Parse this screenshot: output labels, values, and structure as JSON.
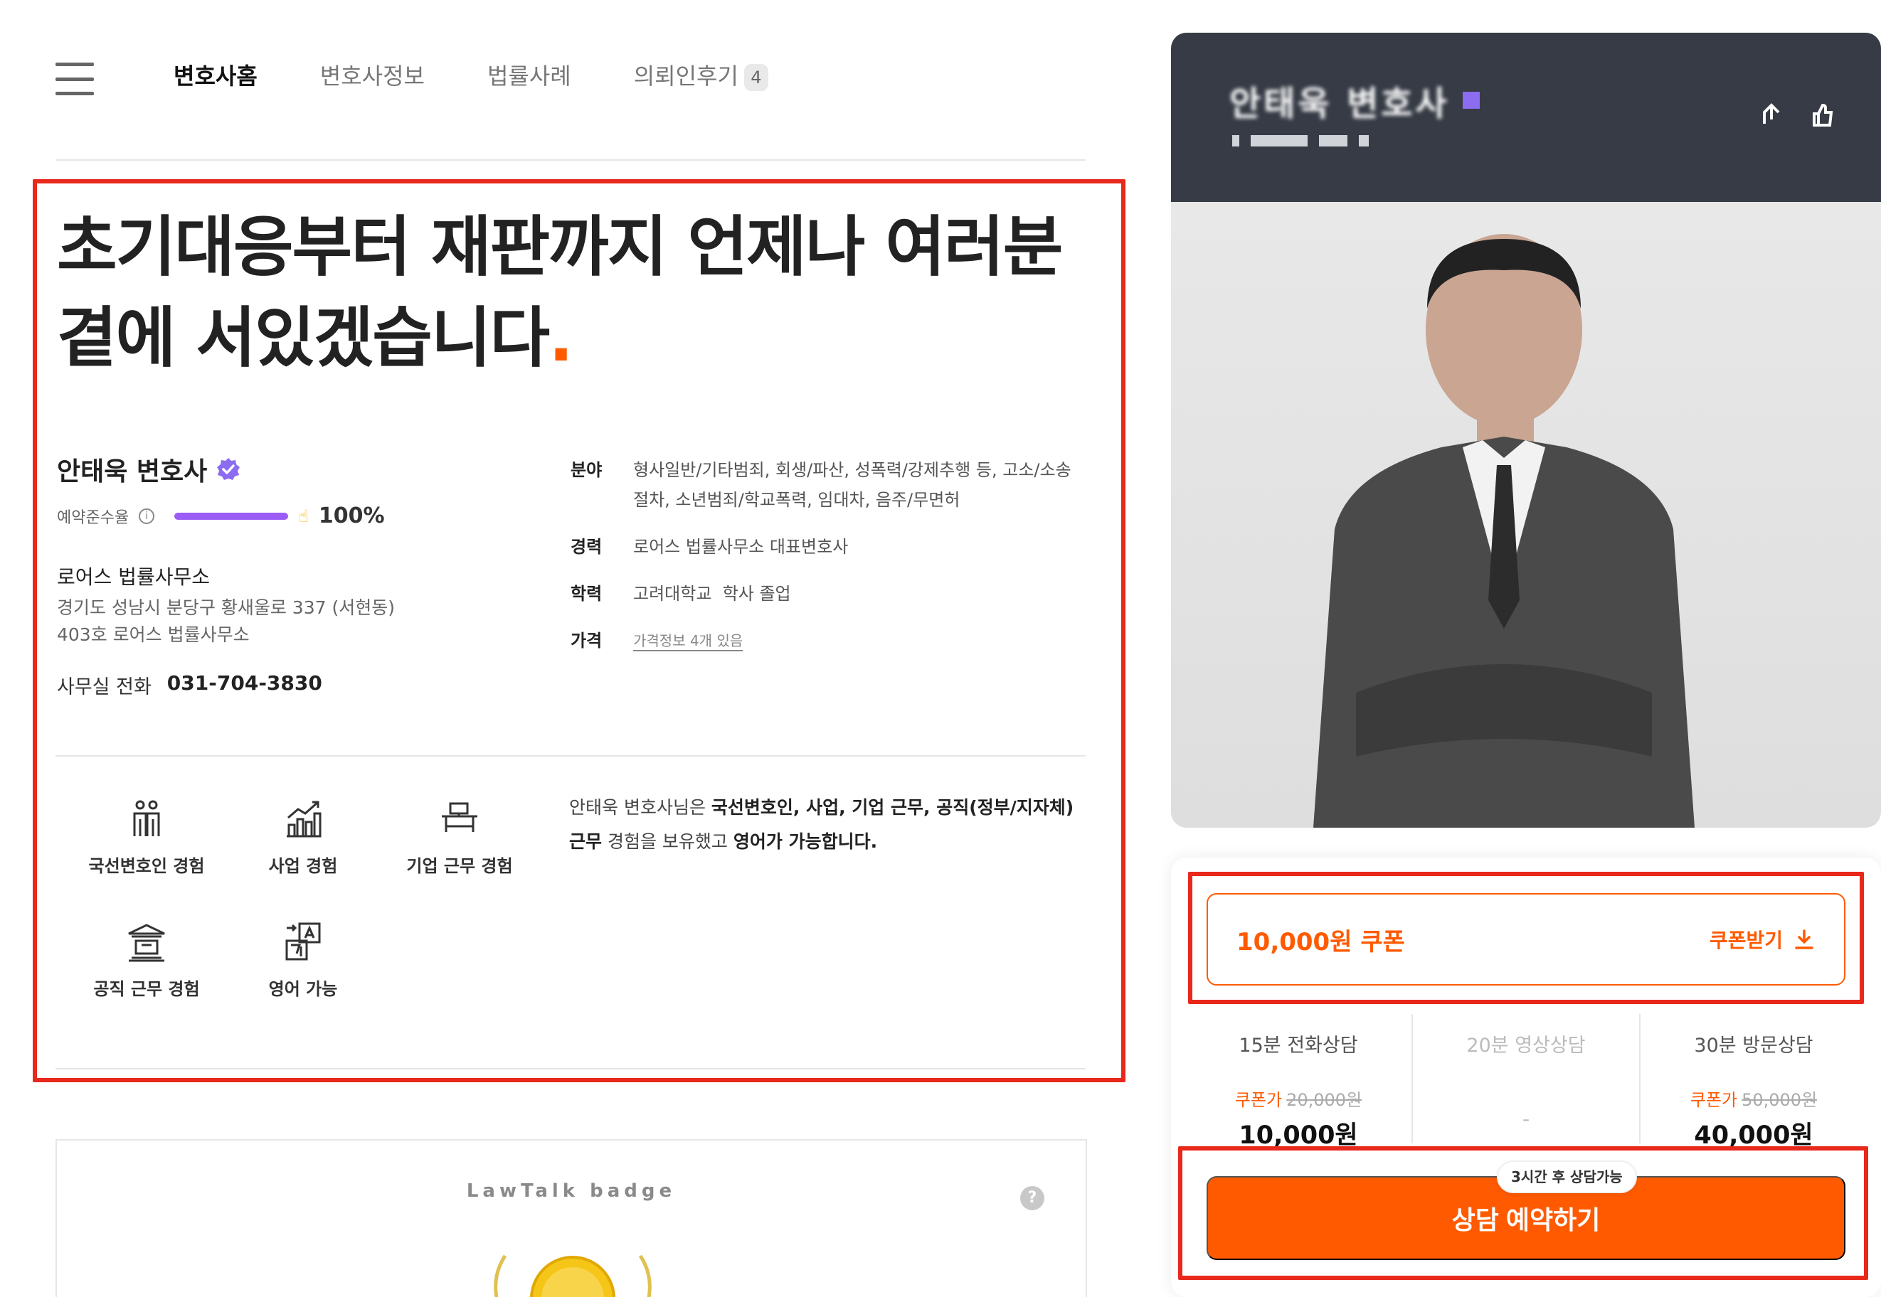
{
  "nav": {
    "tabs": [
      {
        "label": "변호사홈"
      },
      {
        "label": "변호사정보"
      },
      {
        "label": "법률사례"
      },
      {
        "label": "의뢰인후기",
        "count": "4"
      }
    ]
  },
  "headline": {
    "line1": "초기대응부터 재판까지 언제나 여러분",
    "line2": "곁에 서있겠습니다",
    "dot": "."
  },
  "lawyer": {
    "name": "안태욱 변호사",
    "rate_label": "예약준수율",
    "rate_value": "100%",
    "rate_fraction": 1.0,
    "office_name": "로어스 법률사무소",
    "address_line1": "경기도 성남시 분당구 황새울로 337 (서현동)",
    "address_line2": "403호 로어스 법률사무소",
    "phone_label": "사무실 전화",
    "phone": "031-704-3830"
  },
  "info": [
    {
      "key": "분야",
      "value": "형사일반/기타범죄, 회생/파산, 성폭력/강제추행 등, 고소/소송절차, 소년범죄/학교폭력, 임대차, 음주/무면허"
    },
    {
      "key": "경력",
      "value": "로어스 법률사무소 대표변호사"
    },
    {
      "key": "학력",
      "value": "고려대학교  학사 졸업"
    },
    {
      "key": "가격",
      "value": "가격정보 4개 있음"
    }
  ],
  "experiences": [
    {
      "label": "국선변호인 경험",
      "icon": "people-icon"
    },
    {
      "label": "사업 경험",
      "icon": "growth-chart-icon"
    },
    {
      "label": "기업 근무 경험",
      "icon": "desk-icon"
    },
    {
      "label": "공직 근무 경험",
      "icon": "government-building-icon"
    },
    {
      "label": "영어 가능",
      "icon": "translate-icon"
    }
  ],
  "experience_desc": {
    "p1": "안태욱 변호사님은 ",
    "b1": "국선변호인, 사업, 기업 근무, 공직(정부/지자체) 근무",
    "p2": " 경험을 보유했고 ",
    "b2": "영어가 가능합니다."
  },
  "badge_section": {
    "title": "LawTalk badge",
    "help": "?"
  },
  "profile": {
    "name": "안태욱 변호사"
  },
  "booking": {
    "coupon_amount": "10,000원 쿠폰",
    "coupon_get": "쿠폰받기",
    "options": [
      {
        "title": "15분 전화상담",
        "coupon_label": "쿠폰가",
        "original_price": "20,000원",
        "price": "10,000원"
      },
      {
        "title": "20분 영상상담",
        "dash": "-"
      },
      {
        "title": "30분 방문상담",
        "coupon_label": "쿠폰가",
        "original_price": "50,000원",
        "price": "40,000원"
      }
    ],
    "tooltip": "3시간 후 상담가능",
    "reserve_label": "상담 예약하기"
  },
  "colors": {
    "accent": "#ff5a00",
    "highlight_border": "#e8281b",
    "verified": "#8c6cf0",
    "header_dark": "#363b45"
  }
}
